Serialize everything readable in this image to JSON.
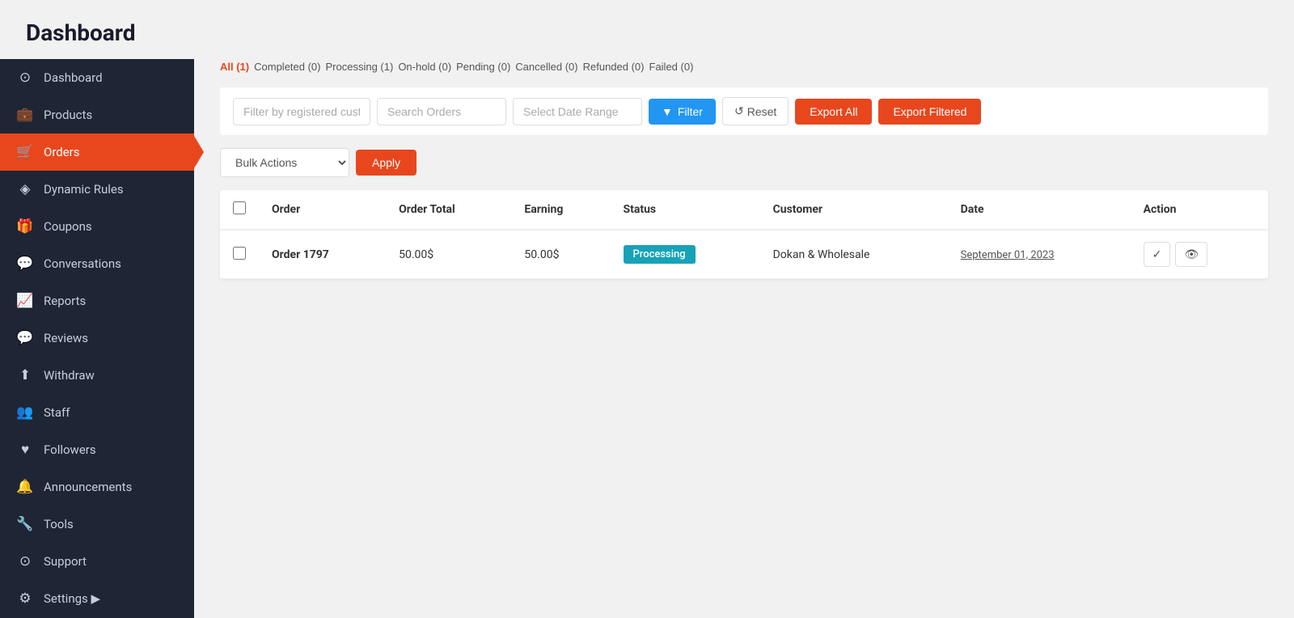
{
  "page": {
    "title": "Dashboard"
  },
  "sidebar": {
    "items": [
      {
        "id": "dashboard",
        "label": "Dashboard",
        "icon": "⚙",
        "icon_name": "dashboard-icon",
        "active": false
      },
      {
        "id": "products",
        "label": "Products",
        "icon": "💼",
        "icon_name": "products-icon",
        "active": false
      },
      {
        "id": "orders",
        "label": "Orders",
        "icon": "🛒",
        "icon_name": "orders-icon",
        "active": true
      },
      {
        "id": "dynamic-rules",
        "label": "Dynamic Rules",
        "icon": "◈",
        "icon_name": "dynamic-rules-icon",
        "active": false
      },
      {
        "id": "coupons",
        "label": "Coupons",
        "icon": "🎁",
        "icon_name": "coupons-icon",
        "active": false
      },
      {
        "id": "conversations",
        "label": "Conversations",
        "icon": "💬",
        "icon_name": "conversations-icon",
        "active": false
      },
      {
        "id": "reports",
        "label": "Reports",
        "icon": "📊",
        "icon_name": "reports-icon",
        "active": false
      },
      {
        "id": "reviews",
        "label": "Reviews",
        "icon": "💬",
        "icon_name": "reviews-icon",
        "active": false
      },
      {
        "id": "withdraw",
        "label": "Withdraw",
        "icon": "⬆",
        "icon_name": "withdraw-icon",
        "active": false
      },
      {
        "id": "staff",
        "label": "Staff",
        "icon": "👥",
        "icon_name": "staff-icon",
        "active": false
      },
      {
        "id": "followers",
        "label": "Followers",
        "icon": "♥",
        "icon_name": "followers-icon",
        "active": false
      },
      {
        "id": "announcements",
        "label": "Announcements",
        "icon": "🔔",
        "icon_name": "announcements-icon",
        "active": false
      },
      {
        "id": "tools",
        "label": "Tools",
        "icon": "🔧",
        "icon_name": "tools-icon",
        "active": false
      },
      {
        "id": "support",
        "label": "Support",
        "icon": "⊙",
        "icon_name": "support-icon",
        "active": false
      },
      {
        "id": "settings",
        "label": "Settings",
        "icon": "⚙",
        "icon_name": "settings-icon",
        "active": false
      }
    ]
  },
  "status_tabs": [
    {
      "label": "All (1)",
      "id": "all",
      "active": true
    },
    {
      "label": "Completed (0)",
      "id": "completed",
      "active": false
    },
    {
      "label": "Processing (1)",
      "id": "processing",
      "active": false
    },
    {
      "label": "On-hold (0)",
      "id": "on-hold",
      "active": false
    },
    {
      "label": "Pending (0)",
      "id": "pending",
      "active": false
    },
    {
      "label": "Cancelled (0)",
      "id": "cancelled",
      "active": false
    },
    {
      "label": "Refunded (0)",
      "id": "refunded",
      "active": false
    },
    {
      "label": "Failed (0)",
      "id": "failed",
      "active": false
    }
  ],
  "filter_bar": {
    "customer_placeholder": "Filter by registered custo",
    "search_placeholder": "Search Orders",
    "date_placeholder": "Select Date Range",
    "filter_label": "Filter",
    "reset_label": "Reset",
    "export_all_label": "Export All",
    "export_filtered_label": "Export Filtered"
  },
  "bulk_actions": {
    "label": "Bulk Actions",
    "apply_label": "Apply"
  },
  "table": {
    "columns": [
      "",
      "Order",
      "Order Total",
      "Earning",
      "Status",
      "Customer",
      "Date",
      "Action"
    ],
    "rows": [
      {
        "id": "1797",
        "order_name": "Order 1797",
        "order_total": "50.00$",
        "earning": "50.00$",
        "status": "Processing",
        "status_class": "processing",
        "customer": "Dokan & Wholesale",
        "date": "September 01, 2023"
      }
    ]
  }
}
